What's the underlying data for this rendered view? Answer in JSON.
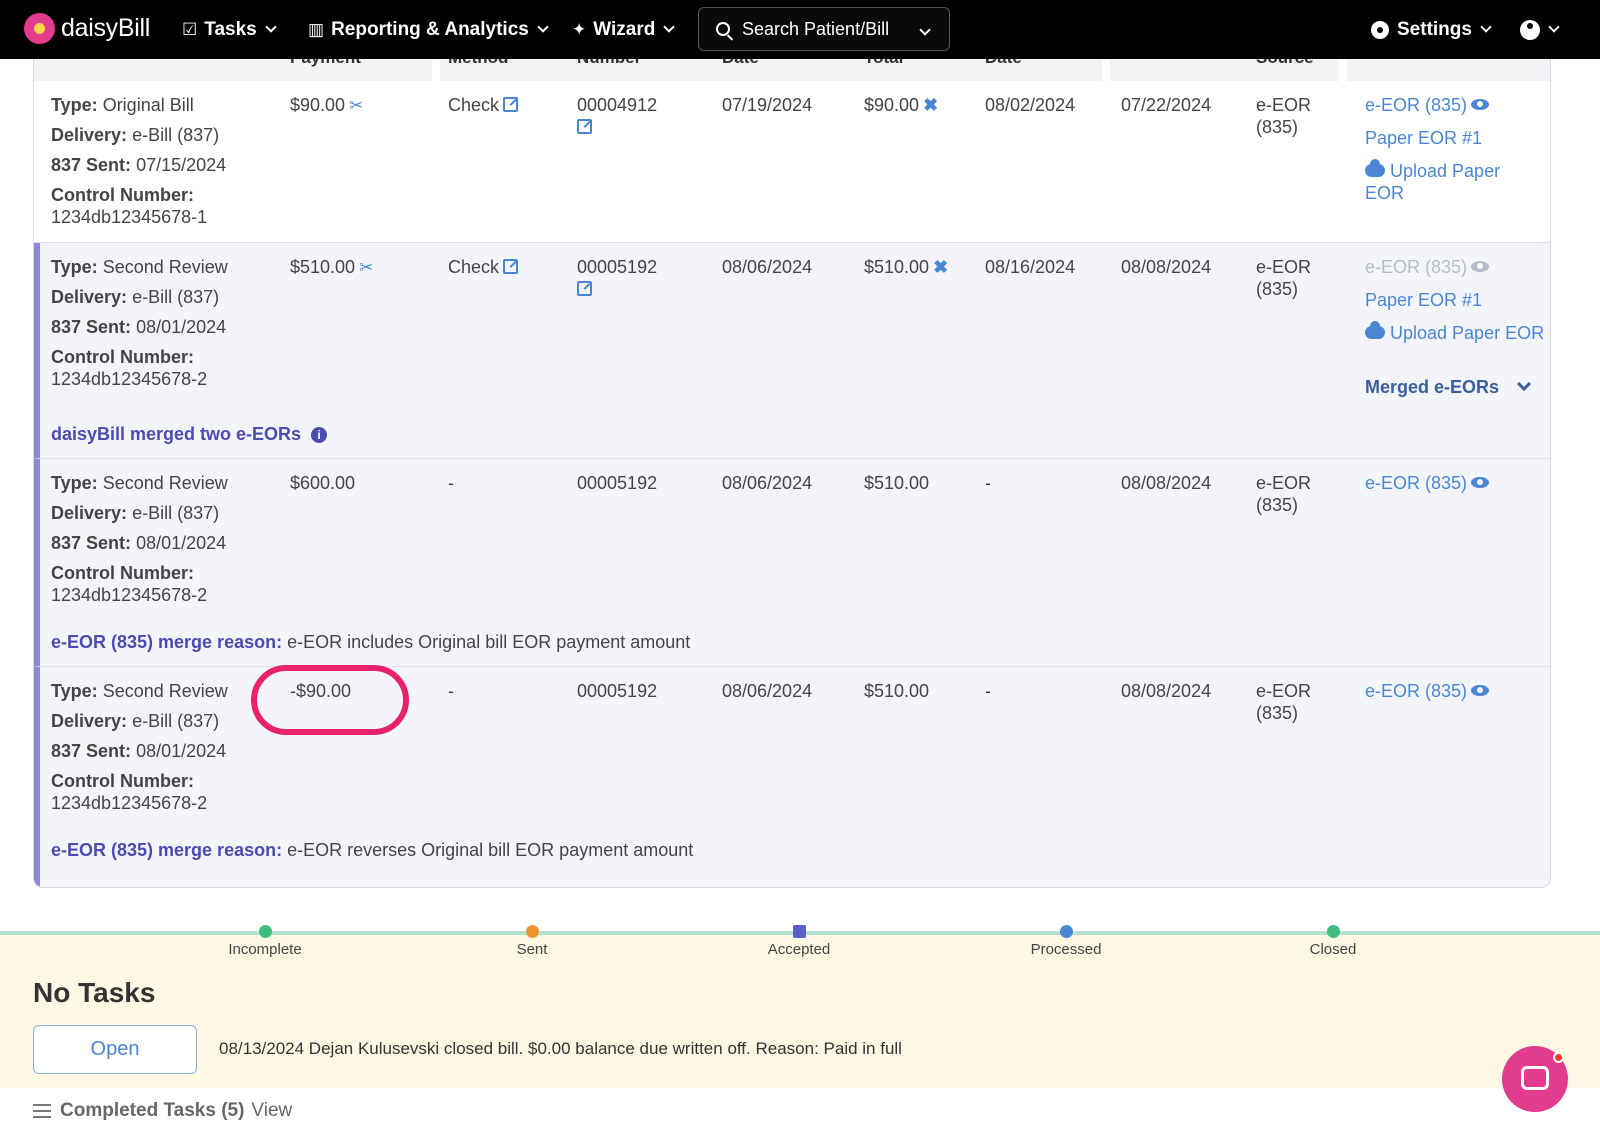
{
  "app": {
    "logo_text": "daisyBill"
  },
  "nav": {
    "tasks": "Tasks",
    "reporting": "Reporting & Analytics",
    "wizard": "Wizard",
    "search_placeholder": "Search Patient/Bill",
    "settings": "Settings"
  },
  "table": {
    "headers": [
      "Payment",
      "Method",
      "Number",
      "Date",
      "Total",
      "Date",
      "Source"
    ],
    "rows": [
      {
        "type_label": "Type:",
        "type": "Original Bill",
        "delivery_label": "Delivery:",
        "delivery": "e-Bill (837)",
        "sent_label": "837 Sent:",
        "sent": "07/15/2024",
        "control_label": "Control Number:",
        "control": "1234db12345678-1",
        "payment": "$90.00",
        "method": "Check",
        "number": "00004912",
        "date": "07/19/2024",
        "total": "$90.00",
        "date2": "08/02/2024",
        "date3": "07/22/2024",
        "source": "e-EOR (835)",
        "eor_link": "e-EOR (835)",
        "paper_eor": "Paper EOR #1",
        "upload": "Upload Paper EOR"
      },
      {
        "type_label": "Type:",
        "type": "Second Review",
        "delivery_label": "Delivery:",
        "delivery": "e-Bill (837)",
        "sent_label": "837 Sent:",
        "sent": "08/01/2024",
        "control_label": "Control Number:",
        "control": "1234db12345678-2",
        "payment": "$510.00",
        "method": "Check",
        "number": "00005192",
        "date": "08/06/2024",
        "total": "$510.00",
        "date2": "08/16/2024",
        "date3": "08/08/2024",
        "source": "e-EOR (835)",
        "eor_link": "e-EOR (835)",
        "paper_eor": "Paper EOR #1",
        "upload": "Upload Paper EOR",
        "merged_toggle": "Merged e-EORs",
        "merged_note": "daisyBill merged two e-EORs"
      },
      {
        "type_label": "Type:",
        "type": "Second Review",
        "delivery_label": "Delivery:",
        "delivery": "e-Bill (837)",
        "sent_label": "837 Sent:",
        "sent": "08/01/2024",
        "control_label": "Control Number:",
        "control": "1234db12345678-2",
        "payment": "$600.00",
        "method": "-",
        "number": "00005192",
        "date": "08/06/2024",
        "total": "$510.00",
        "date2": "-",
        "date3": "08/08/2024",
        "source": "e-EOR (835)",
        "eor_link": "e-EOR (835)",
        "reason_label": "e-EOR (835) merge reason:",
        "reason": "e-EOR includes Original bill EOR payment amount"
      },
      {
        "type_label": "Type:",
        "type": "Second Review",
        "delivery_label": "Delivery:",
        "delivery": "e-Bill (837)",
        "sent_label": "837 Sent:",
        "sent": "08/01/2024",
        "control_label": "Control Number:",
        "control": "1234db12345678-2",
        "payment": "-$90.00",
        "method": "-",
        "number": "00005192",
        "date": "08/06/2024",
        "total": "$510.00",
        "date2": "-",
        "date3": "08/08/2024",
        "source": "e-EOR (835)",
        "eor_link": "e-EOR (835)",
        "reason_label": "e-EOR (835) merge reason:",
        "reason": "e-EOR reverses Original bill EOR payment amount"
      }
    ]
  },
  "status": {
    "steps": [
      {
        "label": "Incomplete",
        "color": "#3fbf7f"
      },
      {
        "label": "Sent",
        "color": "#f0952d"
      },
      {
        "label": "Accepted",
        "color": "#5a5ec9"
      },
      {
        "label": "Processed",
        "color": "#4a86d4"
      },
      {
        "label": "Closed",
        "color": "#3fbf7f"
      }
    ],
    "no_tasks": "No Tasks",
    "open_button": "Open",
    "closed_note": "08/13/2024 Dejan Kulusevski closed bill. $0.00 balance due written off. Reason: Paid in full",
    "completed_tasks": "Completed Tasks (5)",
    "view_link": "View"
  },
  "colors": {
    "accent": "#4a86d4",
    "brand": "#e23c8e",
    "highlight": "#e8226b",
    "merge": "#8a88d8"
  }
}
